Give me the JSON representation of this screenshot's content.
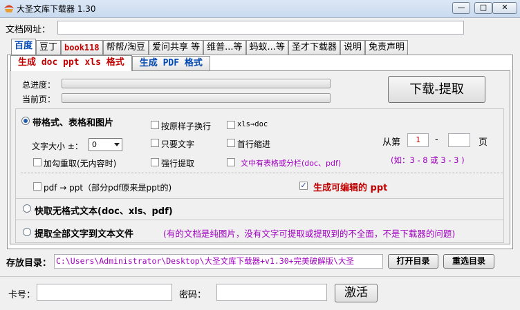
{
  "window": {
    "title": "大圣文库下载器 1.30",
    "controls": {
      "minimize": "—",
      "maximize": "□",
      "close": "✕"
    }
  },
  "url_row": {
    "label": "文档网址：",
    "value": ""
  },
  "top_tabs": [
    {
      "label": "百度",
      "active": true
    },
    {
      "label": "豆丁"
    },
    {
      "label": "book118"
    },
    {
      "label": "帮帮/淘豆"
    },
    {
      "label": "爱问共享 等"
    },
    {
      "label": "维普...等"
    },
    {
      "label": "蚂蚁...等"
    },
    {
      "label": "圣才下载器"
    },
    {
      "label": "说明"
    },
    {
      "label": "免责声明"
    }
  ],
  "sub_tabs": [
    {
      "label": "生成 doc ppt xls 格式",
      "active": true
    },
    {
      "label": "生成 PDF 格式"
    }
  ],
  "progress": {
    "total_label": "总进度：",
    "current_label": "当前页：",
    "total_value": 0,
    "current_value": 0
  },
  "download_button": "下载-提取",
  "options": {
    "with_format": "带格式、表格和图片",
    "by_sample_break": "按原样子换行",
    "xls_to_doc": "xls→doc",
    "font_size_label": "文字大小 ±：",
    "font_size_value": "0",
    "text_only": "只要文字",
    "first_indent": "首行缩进",
    "reload_hook": "加勾重取(无内容时)",
    "force_extract": "强行提取",
    "has_table": "文中有表格或分栏(doc、pdf)",
    "page_from_label": "从第",
    "page_from_value": "1",
    "page_dash": "-",
    "page_to_value": "",
    "page_suffix": "页",
    "page_hint": "(如：3 - 8  或 3 - 3 )",
    "pdf_to_ppt": "pdf → ppt（部分pdf原来是ppt的)",
    "editable_ppt": "生成可编辑的 ppt",
    "quick_no_format": "快取无格式文本(doc、xls、pdf)",
    "extract_all": "提取全部文字到文本文件",
    "extract_all_note": "(有的文档是纯图片，没有文字可提取或提取到的不全面，不是下载器的问题)"
  },
  "save": {
    "label": "存放目录：",
    "path": "C:\\Users\\Administrator\\Desktop\\大圣文库下载器+v1.30+完美破解版\\大圣",
    "open_button": "打开目录",
    "reselect_button": "重选目录"
  },
  "activation": {
    "card_label": "卡号：",
    "card_value": "",
    "password_label": "密码：",
    "password_value": "",
    "activate_button": "激活"
  },
  "colors": {
    "accent_blue": "#0047b3",
    "red": "#c00000",
    "purple": "#a000c0"
  }
}
